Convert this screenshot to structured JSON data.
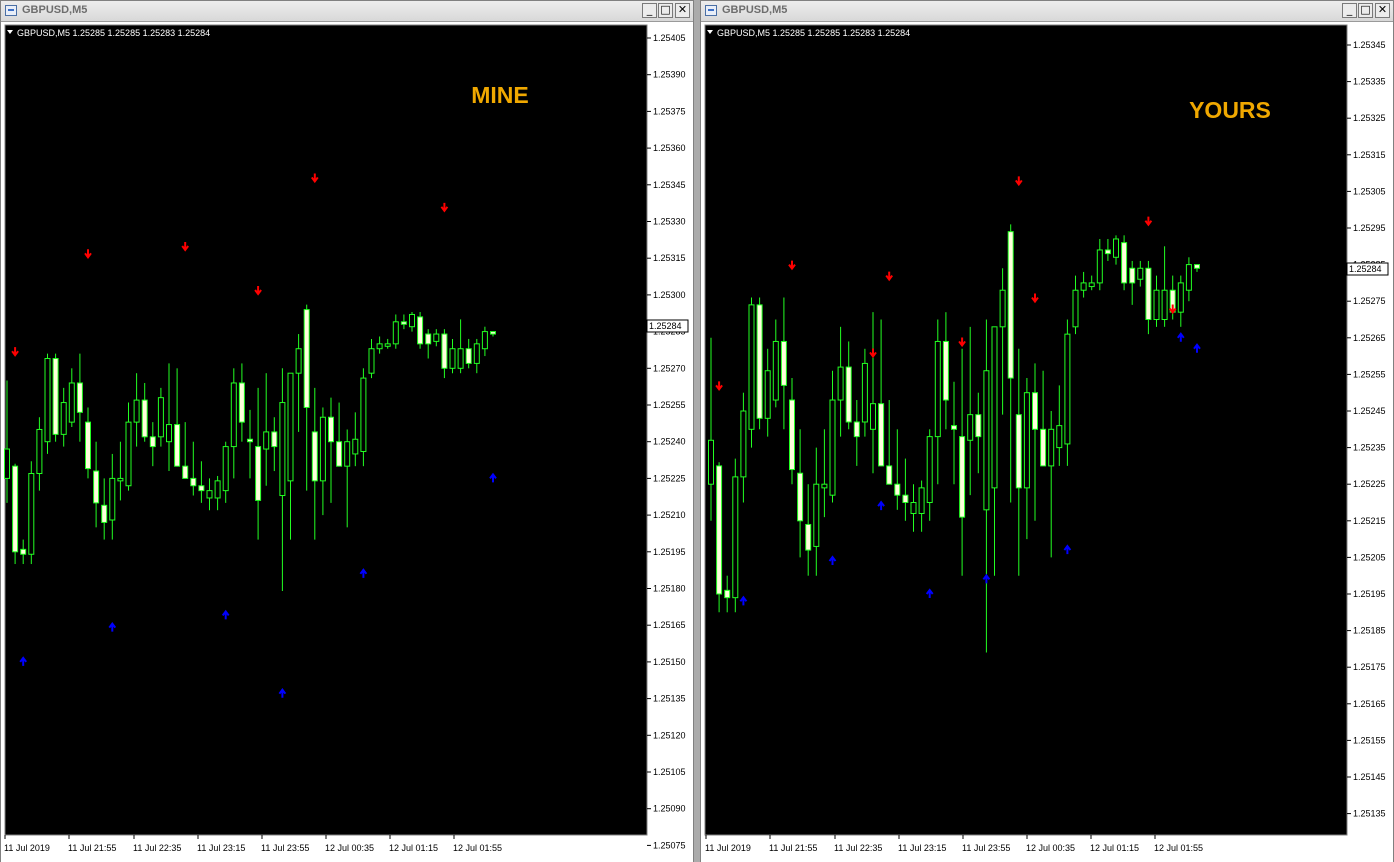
{
  "windows": [
    {
      "title": "GBPUSD,M5",
      "info": "GBPUSD,M5  1.25285 1.25285 1.25283 1.25284",
      "tag": "MINE",
      "current_price": "1.25284",
      "price_labels": [
        "1.25405",
        "1.25390",
        "1.25375",
        "1.25360",
        "1.25345",
        "1.25330",
        "1.25315",
        "1.25300",
        "1.25285",
        "1.25270",
        "1.25255",
        "1.25240",
        "1.25225",
        "1.25210",
        "1.25195",
        "1.25180",
        "1.25165",
        "1.25150",
        "1.25135",
        "1.25120",
        "1.25105",
        "1.25090",
        "1.25075"
      ],
      "time_labels": [
        "11 Jul 2019",
        "11 Jul 21:55",
        "11 Jul 22:35",
        "11 Jul 23:15",
        "11 Jul 23:55",
        "12 Jul 00:35",
        "12 Jul 01:15",
        "12 Jul 01:55"
      ],
      "candles": [
        {
          "o": 1.25225,
          "h": 1.25265,
          "l": 1.25215,
          "c": 1.25237
        },
        {
          "o": 1.2523,
          "h": 1.25231,
          "l": 1.2519,
          "c": 1.25195
        },
        {
          "o": 1.25196,
          "h": 1.252,
          "l": 1.2519,
          "c": 1.25194
        },
        {
          "o": 1.25194,
          "h": 1.25232,
          "l": 1.2519,
          "c": 1.25227
        },
        {
          "o": 1.25227,
          "h": 1.2525,
          "l": 1.2522,
          "c": 1.25245
        },
        {
          "o": 1.2524,
          "h": 1.25276,
          "l": 1.25235,
          "c": 1.25274
        },
        {
          "o": 1.25274,
          "h": 1.25276,
          "l": 1.2524,
          "c": 1.25243
        },
        {
          "o": 1.25243,
          "h": 1.25262,
          "l": 1.25238,
          "c": 1.25256
        },
        {
          "o": 1.25248,
          "h": 1.2527,
          "l": 1.25246,
          "c": 1.25264
        },
        {
          "o": 1.25264,
          "h": 1.25276,
          "l": 1.2524,
          "c": 1.25252
        },
        {
          "o": 1.25248,
          "h": 1.25254,
          "l": 1.25225,
          "c": 1.25229
        },
        {
          "o": 1.25228,
          "h": 1.2524,
          "l": 1.25205,
          "c": 1.25215
        },
        {
          "o": 1.25214,
          "h": 1.25225,
          "l": 1.252,
          "c": 1.25207
        },
        {
          "o": 1.25208,
          "h": 1.25235,
          "l": 1.252,
          "c": 1.25225
        },
        {
          "o": 1.25224,
          "h": 1.2524,
          "l": 1.25216,
          "c": 1.25225
        },
        {
          "o": 1.25222,
          "h": 1.25256,
          "l": 1.2522,
          "c": 1.25248
        },
        {
          "o": 1.25248,
          "h": 1.25268,
          "l": 1.25238,
          "c": 1.25257
        },
        {
          "o": 1.25257,
          "h": 1.25264,
          "l": 1.2524,
          "c": 1.25242
        },
        {
          "o": 1.25242,
          "h": 1.25248,
          "l": 1.2523,
          "c": 1.25238
        },
        {
          "o": 1.25242,
          "h": 1.25262,
          "l": 1.25238,
          "c": 1.25258
        },
        {
          "o": 1.2524,
          "h": 1.25272,
          "l": 1.25228,
          "c": 1.25247
        },
        {
          "o": 1.25247,
          "h": 1.2527,
          "l": 1.25235,
          "c": 1.2523
        },
        {
          "o": 1.2523,
          "h": 1.25248,
          "l": 1.25225,
          "c": 1.25225
        },
        {
          "o": 1.25225,
          "h": 1.2524,
          "l": 1.25218,
          "c": 1.25222
        },
        {
          "o": 1.25222,
          "h": 1.25232,
          "l": 1.25215,
          "c": 1.2522
        },
        {
          "o": 1.25217,
          "h": 1.25225,
          "l": 1.25212,
          "c": 1.2522
        },
        {
          "o": 1.25217,
          "h": 1.25226,
          "l": 1.25212,
          "c": 1.25224
        },
        {
          "o": 1.2522,
          "h": 1.2524,
          "l": 1.25215,
          "c": 1.25238
        },
        {
          "o": 1.25238,
          "h": 1.2527,
          "l": 1.25225,
          "c": 1.25264
        },
        {
          "o": 1.25264,
          "h": 1.25272,
          "l": 1.2524,
          "c": 1.25248
        },
        {
          "o": 1.25241,
          "h": 1.25253,
          "l": 1.25225,
          "c": 1.2524
        },
        {
          "o": 1.25238,
          "h": 1.25262,
          "l": 1.252,
          "c": 1.25216
        },
        {
          "o": 1.25237,
          "h": 1.25268,
          "l": 1.25222,
          "c": 1.25244
        },
        {
          "o": 1.25244,
          "h": 1.2525,
          "l": 1.25228,
          "c": 1.25238
        },
        {
          "o": 1.25218,
          "h": 1.2527,
          "l": 1.25179,
          "c": 1.25256
        },
        {
          "o": 1.25224,
          "h": 1.25268,
          "l": 1.252,
          "c": 1.25268
        },
        {
          "o": 1.25268,
          "h": 1.25284,
          "l": 1.25244,
          "c": 1.25278
        },
        {
          "o": 1.25294,
          "h": 1.25296,
          "l": 1.2522,
          "c": 1.25254
        },
        {
          "o": 1.25244,
          "h": 1.25262,
          "l": 1.252,
          "c": 1.25224
        },
        {
          "o": 1.25224,
          "h": 1.25254,
          "l": 1.2521,
          "c": 1.2525
        },
        {
          "o": 1.2525,
          "h": 1.25258,
          "l": 1.25215,
          "c": 1.2524
        },
        {
          "o": 1.2524,
          "h": 1.25256,
          "l": 1.2523,
          "c": 1.2523
        },
        {
          "o": 1.2523,
          "h": 1.25245,
          "l": 1.25205,
          "c": 1.2524
        },
        {
          "o": 1.25235,
          "h": 1.25252,
          "l": 1.2523,
          "c": 1.25241
        },
        {
          "o": 1.25236,
          "h": 1.2527,
          "l": 1.2523,
          "c": 1.25266
        },
        {
          "o": 1.25268,
          "h": 1.25282,
          "l": 1.25266,
          "c": 1.25278
        },
        {
          "o": 1.25278,
          "h": 1.25283,
          "l": 1.25276,
          "c": 1.2528
        },
        {
          "o": 1.25279,
          "h": 1.25282,
          "l": 1.25278,
          "c": 1.2528
        },
        {
          "o": 1.2528,
          "h": 1.25292,
          "l": 1.25278,
          "c": 1.25289
        },
        {
          "o": 1.25289,
          "h": 1.25292,
          "l": 1.25286,
          "c": 1.25288
        },
        {
          "o": 1.25287,
          "h": 1.25293,
          "l": 1.25285,
          "c": 1.25292
        },
        {
          "o": 1.25291,
          "h": 1.25293,
          "l": 1.25278,
          "c": 1.2528
        },
        {
          "o": 1.25284,
          "h": 1.25286,
          "l": 1.25274,
          "c": 1.2528
        },
        {
          "o": 1.25281,
          "h": 1.25286,
          "l": 1.25279,
          "c": 1.25284
        },
        {
          "o": 1.25284,
          "h": 1.25286,
          "l": 1.25266,
          "c": 1.2527
        },
        {
          "o": 1.2527,
          "h": 1.25282,
          "l": 1.25268,
          "c": 1.25278
        },
        {
          "o": 1.2527,
          "h": 1.2529,
          "l": 1.25268,
          "c": 1.25278
        },
        {
          "o": 1.25278,
          "h": 1.25282,
          "l": 1.2527,
          "c": 1.25272
        },
        {
          "o": 1.25272,
          "h": 1.25282,
          "l": 1.25268,
          "c": 1.2528
        },
        {
          "o": 1.25278,
          "h": 1.25287,
          "l": 1.25275,
          "c": 1.25285
        },
        {
          "o": 1.25285,
          "h": 1.25285,
          "l": 1.25283,
          "c": 1.25284
        }
      ],
      "sell_arrows": [
        {
          "i": 1,
          "p": 1.25277
        },
        {
          "i": 10,
          "p": 1.25317
        },
        {
          "i": 22,
          "p": 1.2532
        },
        {
          "i": 31,
          "p": 1.25302
        },
        {
          "i": 38,
          "p": 1.25348
        },
        {
          "i": 54,
          "p": 1.25336
        }
      ],
      "buy_arrows": [
        {
          "i": 2,
          "p": 1.2515
        },
        {
          "i": 13,
          "p": 1.25164
        },
        {
          "i": 27,
          "p": 1.25169
        },
        {
          "i": 34,
          "p": 1.25137
        },
        {
          "i": 44,
          "p": 1.25186
        },
        {
          "i": 60,
          "p": 1.25225
        }
      ]
    },
    {
      "title": "GBPUSD,M5",
      "info": "GBPUSD,M5  1.25285 1.25285 1.25283 1.25284",
      "tag": "YOURS",
      "current_price": "1.25284",
      "price_labels": [
        "1.25345",
        "1.25335",
        "1.25325",
        "1.25315",
        "1.25305",
        "1.25295",
        "1.25285",
        "1.25275",
        "1.25265",
        "1.25255",
        "1.25245",
        "1.25235",
        "1.25225",
        "1.25215",
        "1.25205",
        "1.25195",
        "1.25185",
        "1.25175",
        "1.25165",
        "1.25155",
        "1.25145",
        "1.25135"
      ],
      "time_labels": [
        "11 Jul 2019",
        "11 Jul 21:55",
        "11 Jul 22:35",
        "11 Jul 23:15",
        "11 Jul 23:55",
        "12 Jul 00:35",
        "12 Jul 01:15",
        "12 Jul 01:55"
      ],
      "sell_arrows": [
        {
          "i": 1,
          "p": 1.25252
        },
        {
          "i": 10,
          "p": 1.25285
        },
        {
          "i": 22,
          "p": 1.25282
        },
        {
          "i": 31,
          "p": 1.25264
        },
        {
          "i": 38,
          "p": 1.25308
        },
        {
          "i": 54,
          "p": 1.25297
        },
        {
          "i": 57,
          "p": 1.25273
        },
        {
          "i": 40,
          "p": 1.25276
        },
        {
          "i": 20,
          "p": 1.25261
        }
      ],
      "buy_arrows": [
        {
          "i": 4,
          "p": 1.25193
        },
        {
          "i": 15,
          "p": 1.25204
        },
        {
          "i": 21,
          "p": 1.25219
        },
        {
          "i": 27,
          "p": 1.25195
        },
        {
          "i": 34,
          "p": 1.25199
        },
        {
          "i": 44,
          "p": 1.25207
        },
        {
          "i": 58,
          "p": 1.25265
        },
        {
          "i": 60,
          "p": 1.25262
        }
      ]
    }
  ],
  "colors": {
    "chart_bg": "#000000",
    "candle": "#22ff22",
    "bull_body": "#000000",
    "bear_body": "#ffffdd",
    "sell_arrow": "#ff0000",
    "buy_arrow": "#0000ff",
    "tag_color": "#f0a800"
  },
  "icons": {
    "window_icon": "chart-window-icon",
    "minimize": "minimize-icon",
    "restore": "restore-icon",
    "close": "close-icon"
  },
  "buttons": {
    "minimize": "_",
    "restore": "□",
    "close": "✕"
  }
}
